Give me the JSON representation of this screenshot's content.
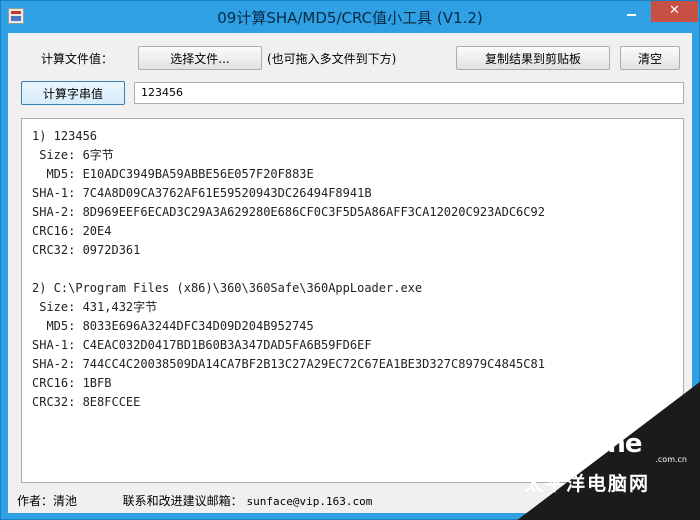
{
  "window": {
    "title": "09计算SHA/MD5/CRC值小工具 (V1.2)",
    "close_glyph": "✕"
  },
  "toolbar": {
    "file_label": "计算文件值：",
    "choose_file_button": "选择文件...",
    "drop_hint": "(也可拖入多文件到下方)",
    "copy_button": "复制结果到剪贴板",
    "clear_button": "清空",
    "string_button": "计算字串值",
    "string_value": "123456"
  },
  "results": [
    {
      "header": "1) 123456",
      "size": " Size: 6字节",
      "md5": "  MD5: E10ADC3949BA59ABBE56E057F20F883E",
      "sha1": "SHA-1: 7C4A8D09CA3762AF61E59520943DC26494F8941B",
      "sha2": "SHA-2: 8D969EEF6ECAD3C29A3A629280E686CF0C3F5D5A86AFF3CA12020C923ADC6C92",
      "crc16": "CRC16: 20E4",
      "crc32": "CRC32: 0972D361"
    },
    {
      "header": "2) C:\\Program Files (x86)\\360\\360Safe\\360AppLoader.exe",
      "size": " Size: 431,432字节",
      "md5": "  MD5: 8033E696A3244DFC34D09D204B952745",
      "sha1": "SHA-1: C4EAC032D0417BD1B60B3A347DAD5FA6B59FD6EF",
      "sha2": "SHA-2: 744CC4C20038509DA14CA7BF2B13C27A29EC72C67EA1BE3D327C8979C4845C81",
      "crc16": "CRC16: 1BFB",
      "crc32": "CRC32: 8E8FCCEE"
    }
  ],
  "status": {
    "author": "作者：清池",
    "contact": "联系和改进建议邮箱：",
    "email": "sunface@vip.163.com"
  },
  "watermark": {
    "logo": "PConline",
    "url": ".com.cn",
    "cn": "太平洋电脑网"
  },
  "colors": {
    "titlebar": "#2ea0e3",
    "close_button": "#c74f43"
  }
}
